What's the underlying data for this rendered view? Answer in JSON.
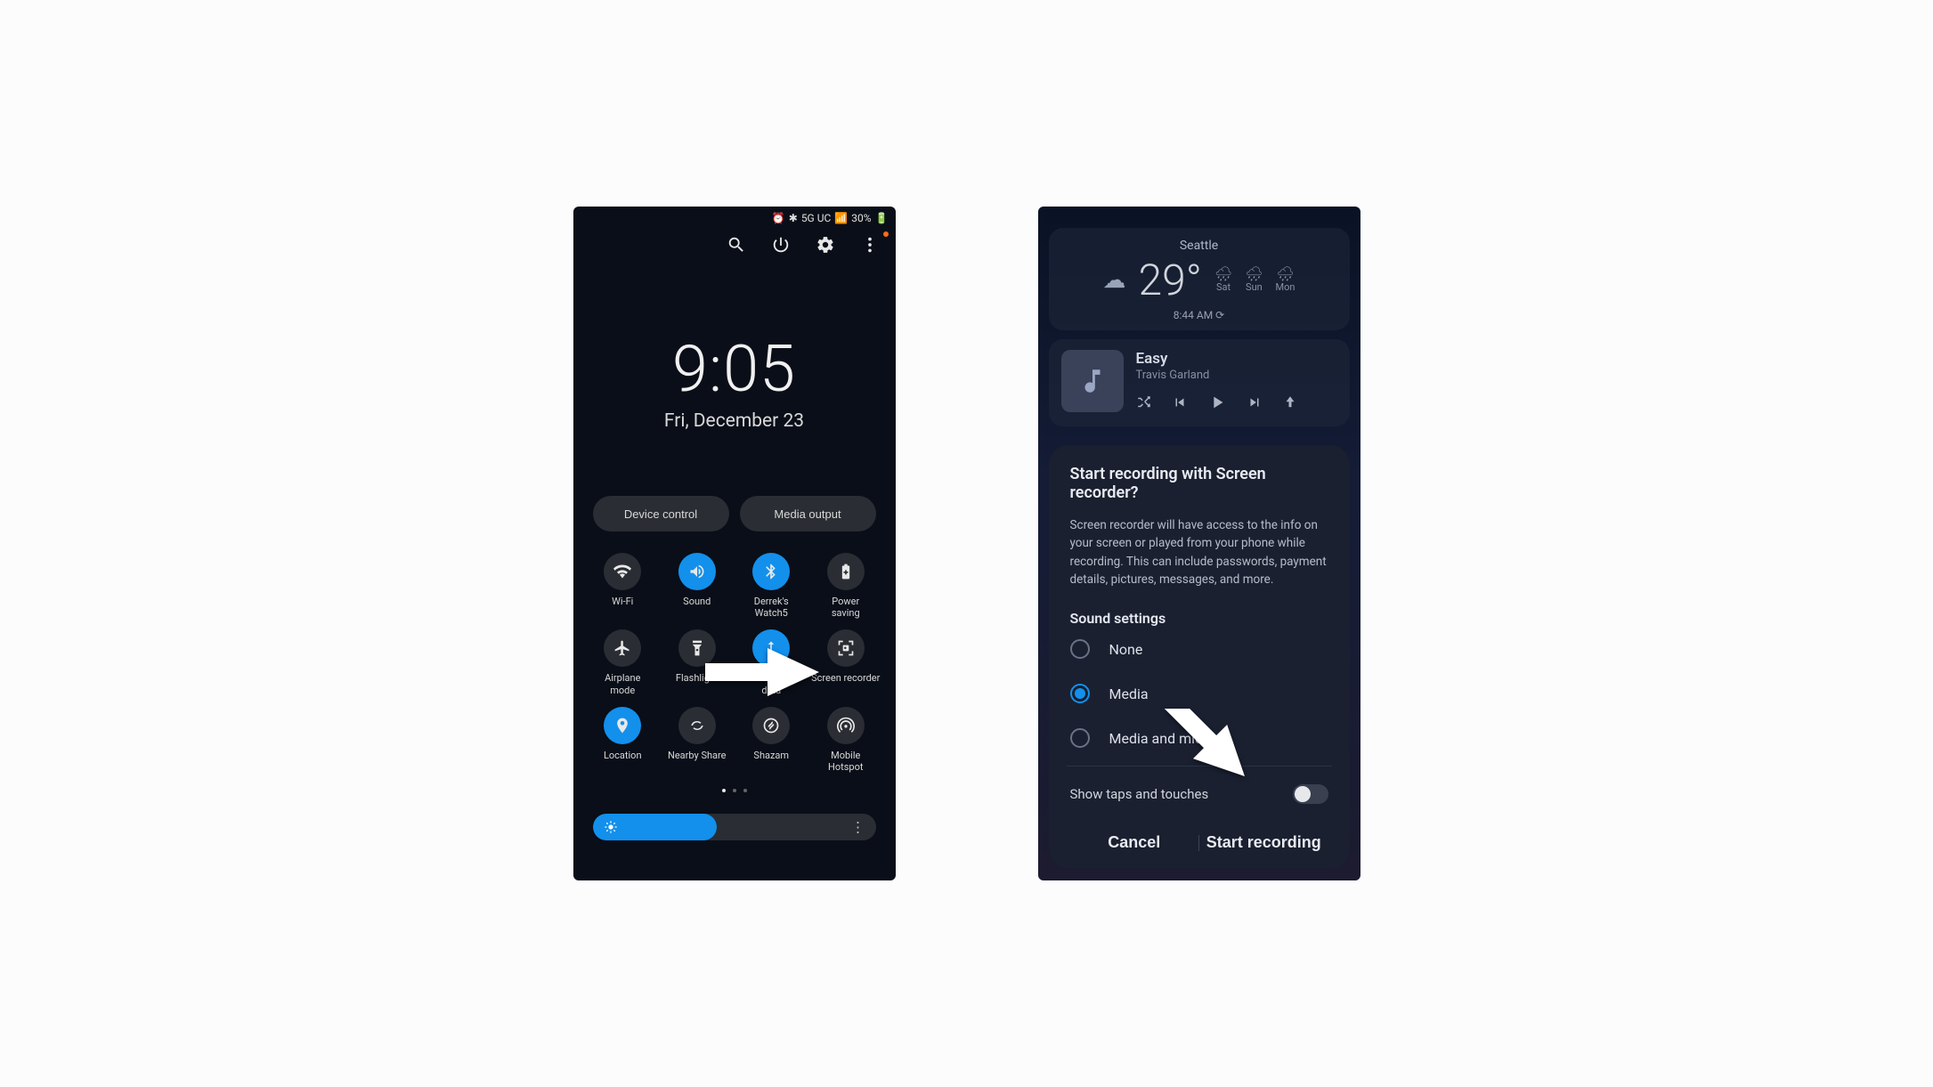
{
  "screenA": {
    "status": {
      "network": "5G UC",
      "battery_pct": "30%",
      "alarm_set": true
    },
    "clock": {
      "time": "9:05",
      "date": "Fri, December 23"
    },
    "shortcuts": {
      "device_control": "Device control",
      "media_output": "Media output"
    },
    "tiles": [
      {
        "id": "wifi",
        "label": "Wi-Fi",
        "on": false
      },
      {
        "id": "sound",
        "label": "Sound",
        "on": true
      },
      {
        "id": "bluetooth",
        "label": "Derrek's\nWatch5",
        "on": true
      },
      {
        "id": "power",
        "label": "Power\nsaving",
        "on": false
      },
      {
        "id": "airplane",
        "label": "Airplane\nmode",
        "on": false
      },
      {
        "id": "flashlight",
        "label": "Flashlight",
        "on": false
      },
      {
        "id": "mobiledata",
        "label": "Mobile\ndata",
        "on": true
      },
      {
        "id": "screenrec",
        "label": "Screen recorder",
        "on": false
      },
      {
        "id": "location",
        "label": "Location",
        "on": true
      },
      {
        "id": "nearby",
        "label": "Nearby Share",
        "on": false
      },
      {
        "id": "shazam",
        "label": "Shazam",
        "on": false
      },
      {
        "id": "hotspot",
        "label": "Mobile\nHotspot",
        "on": false
      }
    ],
    "brightness_pct": 44
  },
  "screenB": {
    "weather": {
      "city": "Seattle",
      "temp": "29°",
      "days": [
        "Sat",
        "Sun",
        "Mon"
      ],
      "updated": "8:44 AM"
    },
    "media": {
      "title": "Easy",
      "artist": "Travis Garland"
    },
    "dialog": {
      "title": "Start recording with Screen recorder?",
      "message": "Screen recorder will have access to the info on your screen or played from your phone while recording. This can include passwords, payment details, pictures, messages, and more.",
      "section_label": "Sound settings",
      "options": {
        "none": "None",
        "media": "Media",
        "media_mic": "Media and mic"
      },
      "selected": "media",
      "toggle_label": "Show taps and touches",
      "toggle_on": false,
      "actions": {
        "cancel": "Cancel",
        "start": "Start recording"
      }
    }
  }
}
